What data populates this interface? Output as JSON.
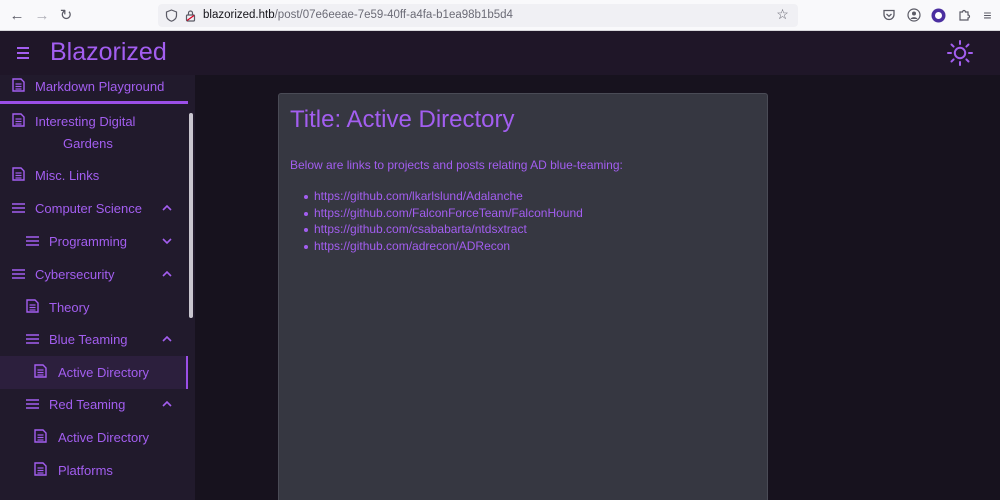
{
  "browser": {
    "url_host": "blazorized.htb",
    "url_path": "/post/07e6eeae-7e59-40ff-a4fa-b1ea98b1b5d4",
    "icons": [
      "back-icon",
      "forward-icon",
      "reload-icon",
      "shield-icon",
      "lock-icon",
      "bookmark-star-icon",
      "pocket-icon",
      "account-icon",
      "extension-icon",
      "extensions-puzzle-icon",
      "app-menu-icon"
    ]
  },
  "app": {
    "title": "Blazorized",
    "accent_color": "#a35ef0"
  },
  "sidebar": {
    "items": [
      {
        "label": "Markdown Playground",
        "icon": "document-icon"
      },
      {
        "label": "Interesting Digital",
        "label2": "Gardens",
        "icon": "document-icon"
      },
      {
        "label": "Misc. Links",
        "icon": "document-icon"
      },
      {
        "label": "Computer Science",
        "icon": "list-icon",
        "state": "expanded"
      },
      {
        "label": "Programming",
        "icon": "list-icon",
        "state": "collapsed"
      },
      {
        "label": "Cybersecurity",
        "icon": "list-icon",
        "state": "expanded"
      },
      {
        "label": "Theory",
        "icon": "document-icon"
      },
      {
        "label": "Blue Teaming",
        "icon": "list-icon",
        "state": "expanded"
      },
      {
        "label": "Active Directory",
        "icon": "document-icon",
        "active": true
      },
      {
        "label": "Red Teaming",
        "icon": "list-icon",
        "state": "expanded"
      },
      {
        "label": "Active Directory",
        "icon": "document-icon"
      },
      {
        "label": "Platforms",
        "icon": "document-icon"
      }
    ]
  },
  "post": {
    "title": "Title: Active Directory",
    "intro": "Below are links to projects and posts relating AD blue-teaming:",
    "links": [
      "https://github.com/lkarlslund/Adalanche",
      "https://github.com/FalconForceTeam/FalconHound",
      "https://github.com/csababarta/ntdsxtract",
      "https://github.com/adrecon/ADRecon"
    ]
  }
}
